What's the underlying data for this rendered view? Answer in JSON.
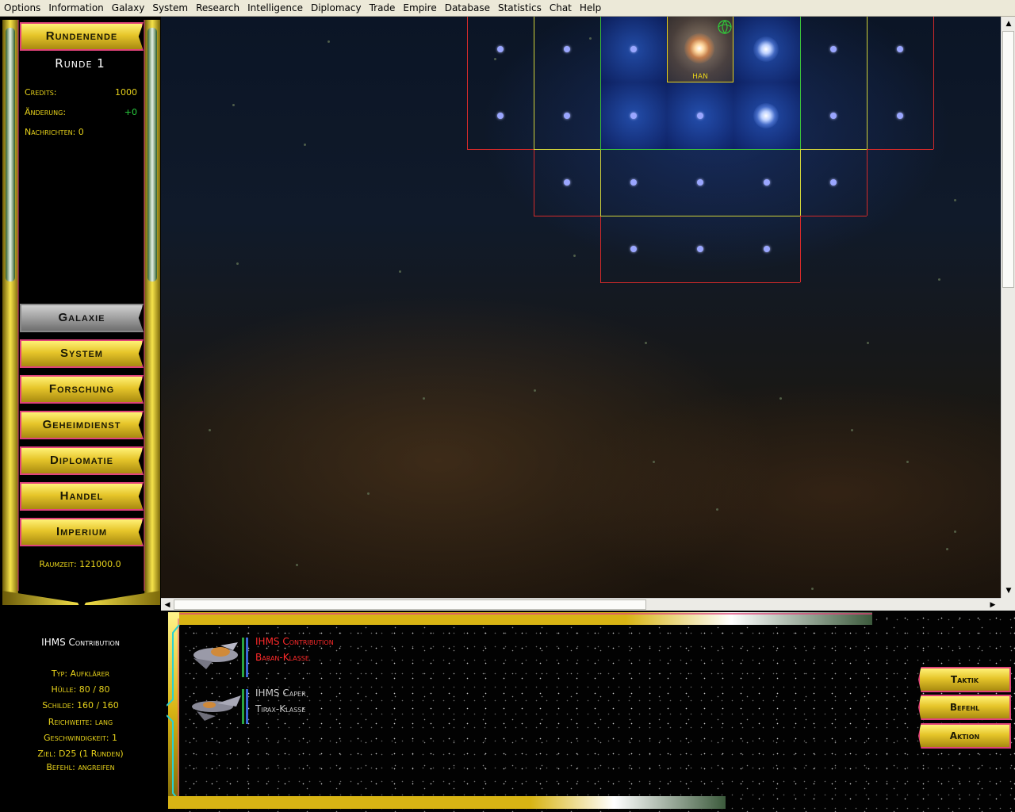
{
  "menu": [
    "Options",
    "Information",
    "Galaxy",
    "System",
    "Research",
    "Intelligence",
    "Diplomacy",
    "Trade",
    "Empire",
    "Database",
    "Statistics",
    "Chat",
    "Help"
  ],
  "left": {
    "end_turn_label": "Rundenende",
    "round_label": "Runde 1",
    "credits_label": "Credits:",
    "credits_value": "1000",
    "change_label": "Änderung:",
    "change_value": "+0",
    "messages_label": "Nachrichten: 0",
    "nav": [
      "Galaxie",
      "System",
      "Forschung",
      "Geheimdienst",
      "Diplomatie",
      "Handel",
      "Imperium"
    ],
    "active_nav": "Galaxie",
    "spacetime_label": "Raumzeit: 121000.0"
  },
  "map": {
    "home_system_label": "HAN"
  },
  "selected_ship": {
    "name": "IHMS Contribution",
    "type": "Typ: Aufklärer",
    "hull": "Hülle: 80 / 80",
    "shields": "Schilde: 160 / 160",
    "range": "Reichweite: lang",
    "speed": "Geschwindigkeit: 1",
    "target": "Ziel: D25 (1 Runden)",
    "order": "Befehl: angreifen"
  },
  "fleet": [
    {
      "name": "IHMS Contribution",
      "class": "Baran-Klasse",
      "color": "#ff2a2a"
    },
    {
      "name": "IHMS Caper",
      "class": "Tirax-Klasse",
      "color": "#c8c8c8"
    }
  ],
  "commands": [
    "Taktik",
    "Befehl",
    "Aktion"
  ],
  "colors": {
    "accent_gold": "#e7d21b",
    "frame_pink": "#e0437a",
    "grid_red": "#d42a2a",
    "grid_yellow": "#cfd23a",
    "selected_red": "#ff2a2a"
  }
}
